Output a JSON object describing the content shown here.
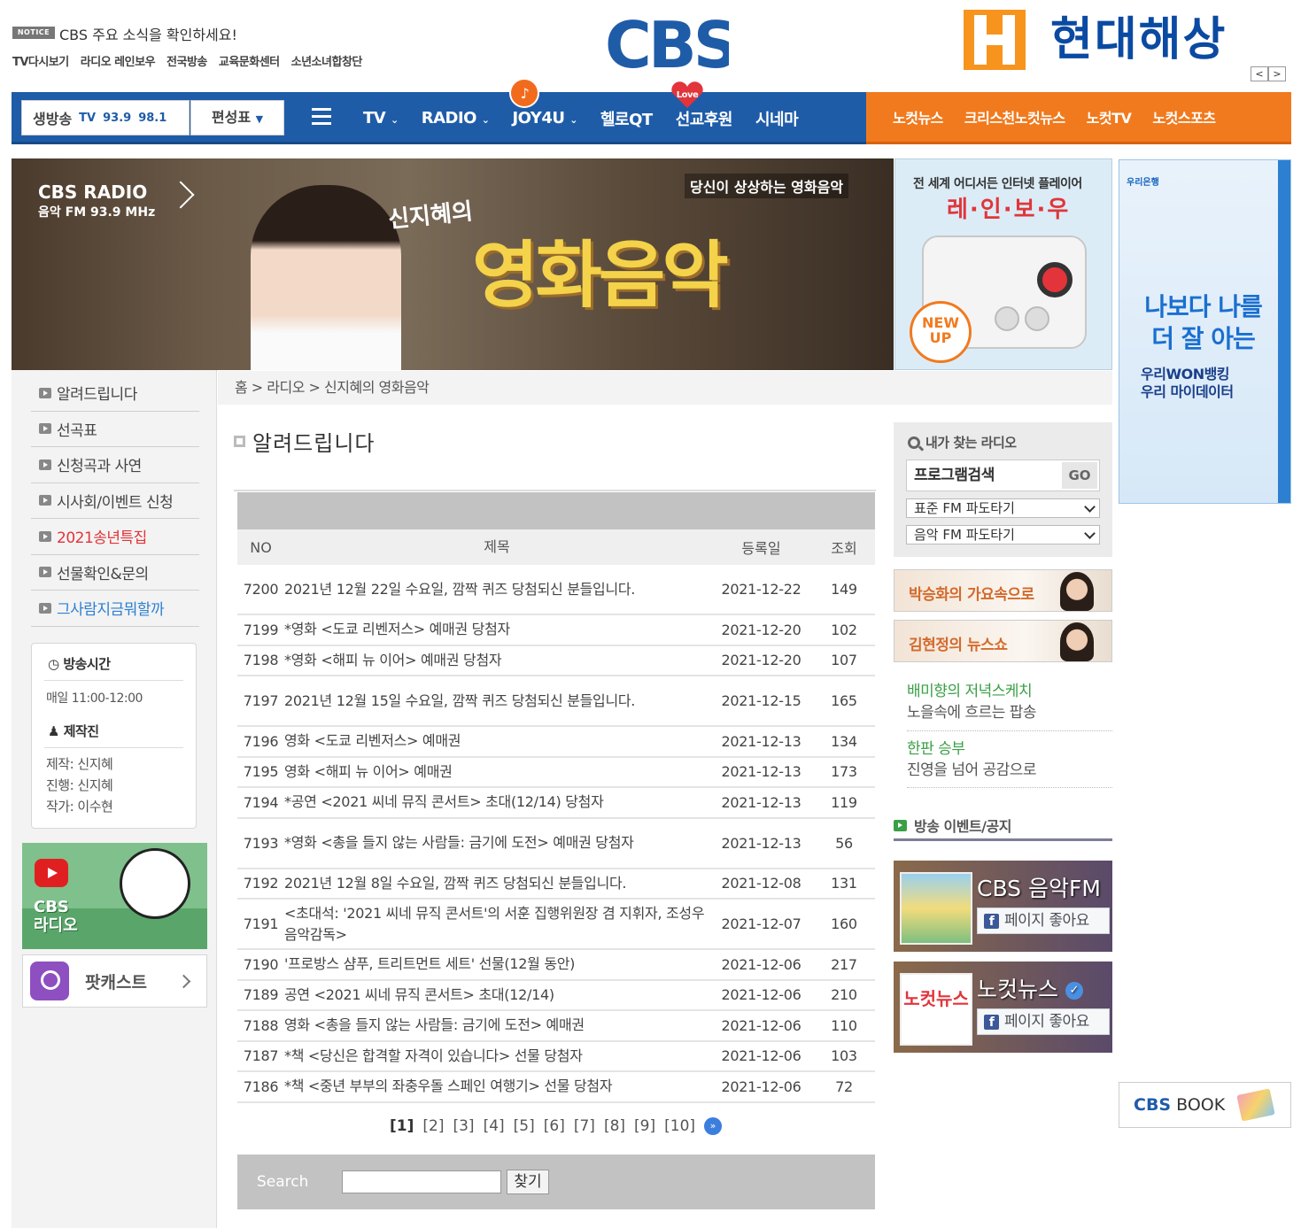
{
  "top": {
    "notice_badge": "NOTICE",
    "notice_text": "CBS 주요 소식을 확인하세요!",
    "links": [
      "TV다시보기",
      "라디오 레인보우",
      "전국방송",
      "교육문화센터",
      "소년소녀합창단"
    ],
    "logo": "CBS",
    "ad_brand": "현대해상",
    "ad_prev": "<",
    "ad_next": ">"
  },
  "nav": {
    "live_label": "생방송",
    "live_tv": "TV",
    "live_freq1": "93.9",
    "live_freq2": "98.1",
    "schedule_label": "편성표",
    "items": [
      "TV",
      "RADIO",
      "JOY4U",
      "헬로QT",
      "선교후원",
      "시네마"
    ],
    "joy_badge": "♪",
    "love_badge": "Love",
    "right_items": [
      "노컷뉴스",
      "크리스천노컷뉴스",
      "노컷TV",
      "노컷스포츠"
    ]
  },
  "banner": {
    "radio_label": "CBS RADIO",
    "radio_sub": "음악 FM 93.9 MHz",
    "program_by": "신지혜의",
    "program_name": "영화음악",
    "tagline": "당신이 상상하는 영화음악"
  },
  "rainbow_ad": {
    "line1": "전 세계 어디서든 인터넷 플레이어",
    "line2": "레·인·보·우",
    "newup_1": "NEW",
    "newup_2": "UP"
  },
  "woori_ad": {
    "brand": "우리은행",
    "slogan_1": "나보다 나를",
    "slogan_2": "더 잘 아는",
    "sub_1": "우리WON뱅킹",
    "sub_2": "우리 마이데이터"
  },
  "sidebar": {
    "items": [
      {
        "label": "알려드립니다",
        "style": "normal"
      },
      {
        "label": "선곡표",
        "style": "normal"
      },
      {
        "label": "신청곡과 사연",
        "style": "normal"
      },
      {
        "label": "시사회/이벤트 신청",
        "style": "normal"
      },
      {
        "label": "2021송년특집",
        "style": "red"
      },
      {
        "label": "선물확인&문의",
        "style": "normal"
      },
      {
        "label": "그사람지금뭐할까",
        "style": "blue"
      }
    ],
    "airtime_title": "방송시간",
    "airtime_value": "매일 11:00-12:00",
    "staff_title": "제작진",
    "staff": [
      "제작: 신지혜",
      "진행: 신지혜",
      "작가: 이수현"
    ],
    "youtube_label_1": "CBS",
    "youtube_label_2": "라디오",
    "podcast_label": "팟캐스트"
  },
  "breadcrumb": "홈 > 라디오 > 신지혜의 영화음악",
  "page_title": "알려드립니다",
  "table": {
    "headers": {
      "no": "NO",
      "title": "제목",
      "date": "등록일",
      "views": "조회"
    },
    "rows": [
      {
        "no": "7200",
        "title": "2021년 12월 22일 수요일, 깜짝 퀴즈 당첨되신 분들입니다.",
        "date": "2021-12-22",
        "views": "149"
      },
      {
        "no": "7199",
        "title": "*영화 <도쿄 리벤저스> 예매권 당첨자",
        "date": "2021-12-20",
        "views": "102"
      },
      {
        "no": "7198",
        "title": "*영화 <해피 뉴 이어> 예매권 당첨자",
        "date": "2021-12-20",
        "views": "107"
      },
      {
        "no": "7197",
        "title": "2021년 12월 15일 수요일, 깜짝 퀴즈 당첨되신 분들입니다.",
        "date": "2021-12-15",
        "views": "165"
      },
      {
        "no": "7196",
        "title": "영화 <도쿄 리벤저스> 예매권",
        "date": "2021-12-13",
        "views": "134"
      },
      {
        "no": "7195",
        "title": "영화 <해피 뉴 이어> 예매권",
        "date": "2021-12-13",
        "views": "173"
      },
      {
        "no": "7194",
        "title": "*공연 <2021 씨네 뮤직 콘서트> 초대(12/14) 당첨자",
        "date": "2021-12-13",
        "views": "119"
      },
      {
        "no": "7193",
        "title": "*영화 <총을 들지 않는 사람들: 금기에 도전> 예매권 당첨자",
        "date": "2021-12-13",
        "views": "56"
      },
      {
        "no": "7192",
        "title": "2021년 12월 8일 수요일, 깜짝 퀴즈 당첨되신 분들입니다.",
        "date": "2021-12-08",
        "views": "131"
      },
      {
        "no": "7191",
        "title": "<초대석: '2021 씨네 뮤직 콘서트'의 서훈 집행위원장 겸 지휘자, 조성우 음악감독>",
        "date": "2021-12-07",
        "views": "160"
      },
      {
        "no": "7190",
        "title": "'프로방스 샴푸, 트리트먼트 세트' 선물(12월 동안)",
        "date": "2021-12-06",
        "views": "217"
      },
      {
        "no": "7189",
        "title": "공연 <2021 씨네 뮤직 콘서트> 초대(12/14)",
        "date": "2021-12-06",
        "views": "210"
      },
      {
        "no": "7188",
        "title": "영화 <총을 들지 않는 사람들: 금기에 도전> 예매권",
        "date": "2021-12-06",
        "views": "110"
      },
      {
        "no": "7187",
        "title": "*책 <당신은 합격할 자격이 있습니다> 선물 당첨자",
        "date": "2021-12-06",
        "views": "103"
      },
      {
        "no": "7186",
        "title": "*책 <중년 부부의 좌충우돌 스페인 여행기> 선물 당첨자",
        "date": "2021-12-06",
        "views": "72"
      }
    ]
  },
  "pager": {
    "pages": [
      "[1]",
      "[2]",
      "[3]",
      "[4]",
      "[5]",
      "[6]",
      "[7]",
      "[8]",
      "[9]",
      "[10]"
    ],
    "next": "»"
  },
  "search": {
    "label": "Search",
    "value": "",
    "button": "찾기"
  },
  "right": {
    "find_title": "내가 찾는 라디오",
    "program_search": "프로그램검색",
    "go": "GO",
    "select1": "표준 FM 파도타기",
    "select2": "음악 FM 파도타기",
    "banner1": "박승화의 가요속으로",
    "banner2": "김현정의 뉴스쇼",
    "links": [
      {
        "title": "배미향의 저녁스케치",
        "desc": "노을속에 흐르는 팝송"
      },
      {
        "title": "한판 승부",
        "desc": "진영을 넘어 공감으로"
      }
    ],
    "events_title": "방송 이벤트/공지",
    "fb": [
      {
        "name": "CBS 음악FM",
        "like": "페이지 좋아요"
      },
      {
        "name": "노컷뉴스",
        "like": "페이지 좋아요"
      }
    ],
    "fb_icon": "f",
    "nocut_thumb": "노컷뉴스",
    "book_brand": "CBS",
    "book_label": "BOOK"
  },
  "colors": {
    "nav_blue": "#1f5ca8",
    "nav_orange": "#f17a1e",
    "accent_red": "#e2343a",
    "accent_blue": "#2d7fd2",
    "accent_green": "#39a045"
  }
}
